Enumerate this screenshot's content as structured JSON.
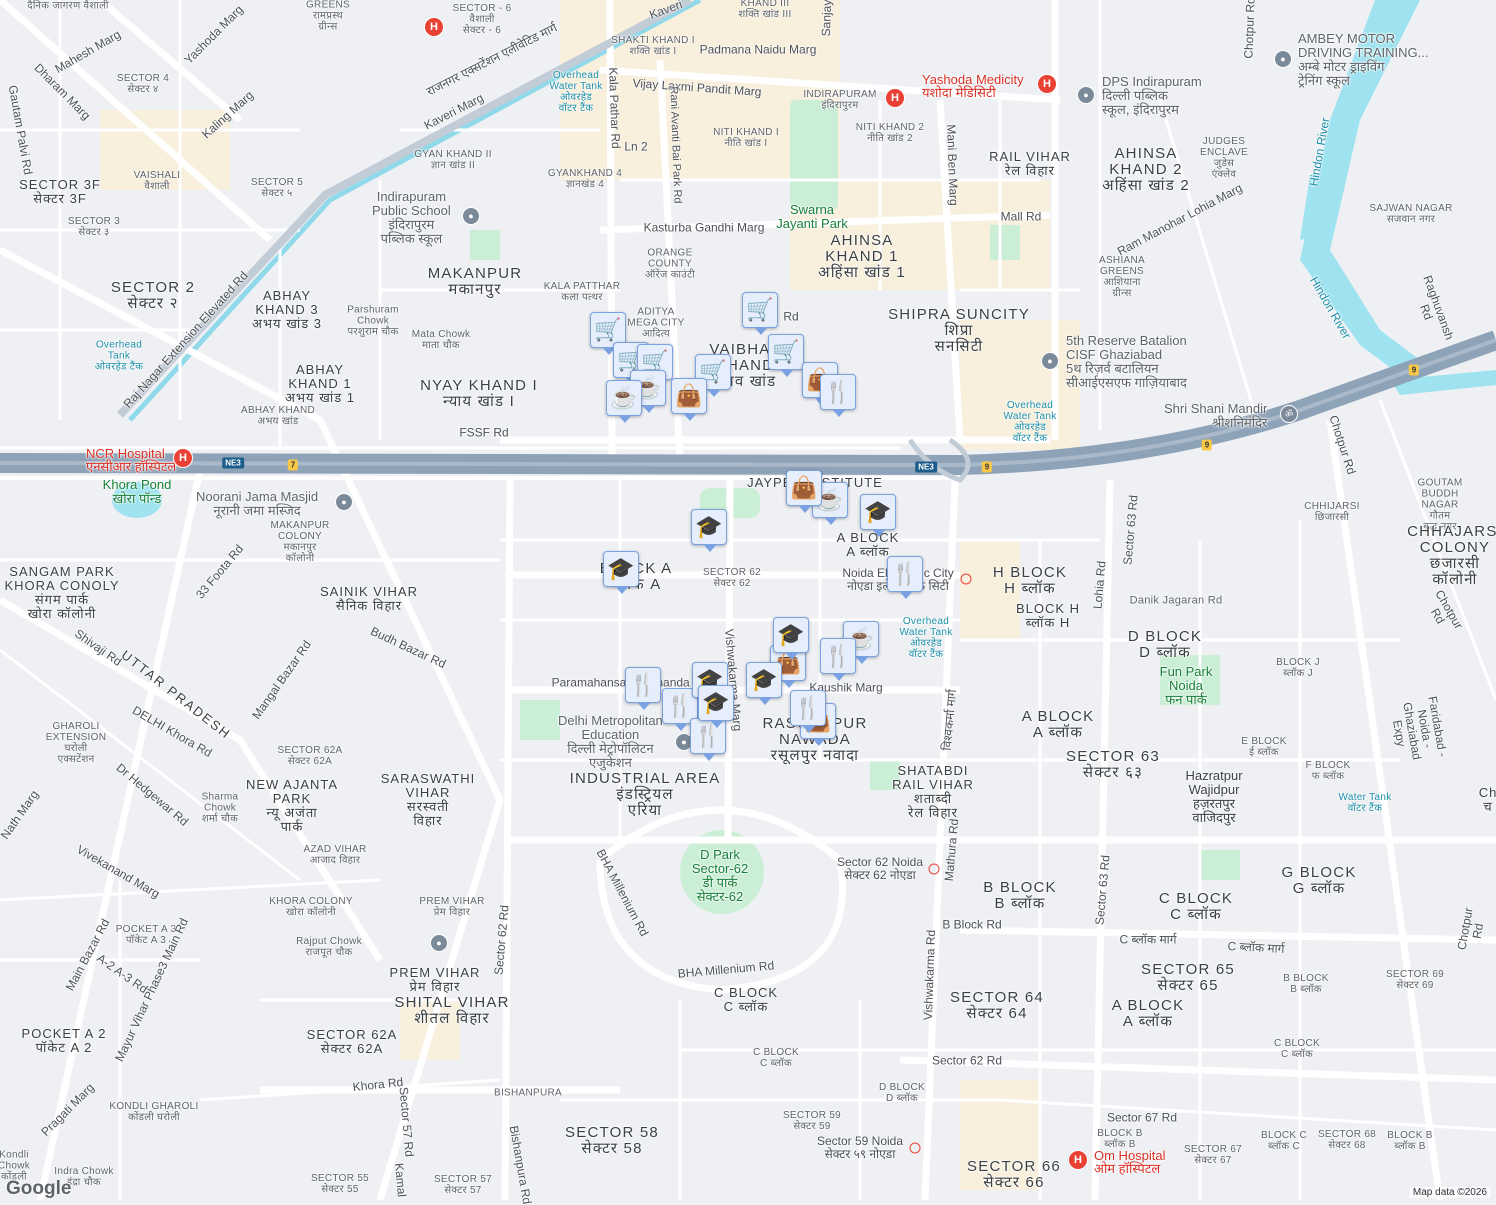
{
  "map": {
    "attribution": "Map data ©2026",
    "logo": "Google",
    "colors": {
      "land": "#eef0f3",
      "road": "#ffffff",
      "highway": "#8ea2b8",
      "water": "#9fe3f0",
      "park": "#cbeed6",
      "urban": "#f8efdc",
      "marker_fill": "#e6eefc",
      "marker_border": "#7aa2e3",
      "marker_icon": "#0b4a70"
    }
  },
  "labels": [
    "दैनिक जागरण वैशाली",
    "GREENS\nरामप्रस्थ\nग्रीन्स",
    "VAISHALI\nSECTOR - 6\nवैशाली\nसेक्टर - 6",
    "KHAND III\nशक्ति खांड III",
    "SHAKTI KHAND I\nशक्ति खांड I",
    "Padmana Naidu Marg",
    "Vijay Laxmi Pandit Marg",
    "Overhead\nWater Tank\nओवरहेड\nवॉटर टैंक",
    "INDIRAPURAM\nइंदिरापुरम",
    "Yashoda Medicity\nयशोदा मेडिसिटी",
    "DPS Indirapuram\nदिल्ली पब्लिक\nस्कूल, इंदिरापुरम",
    "AMBEY MOTOR\nDRIVING TRAINING...\nअम्बे मोटर ड्राइविंग\nट्रेनिंग स्कूल",
    "SECTOR 4\nसेक्टर ४",
    "Mahesh Marg",
    "Yashoda Marg",
    "Dharam Marg",
    "Gautam Palvi Rd",
    "Kaling Marg",
    "VAISHALI\nवैशाली",
    "SECTOR 3F\nसेक्टर 3F",
    "GYAN KHAND II\nज्ञान खांड II",
    "SECTOR 5\nसेक्टर ५",
    "GYANKHAND 4\nज्ञानखंड 4",
    "NITI KHAND I\nनीति खांड I",
    "NITI KHAND 2\nनीति खांड 2",
    "RAIL VIHAR\nरेल विहार",
    "AHINSA\nKHAND 2\nअहिंसा खांड 2",
    "JUDGES\nENCLAVE\nजुडेस\nएंक्लेव",
    "Hindon River",
    "SAJWAN NAGAR\nसजवान नगर",
    "Ram Manohar Lohia Marg",
    "Mall Rd",
    "Swarna\nJayanti Park",
    "Kasturba Gandhi Marg",
    "SECTOR 3\nसेक्टर ३",
    "Indirapuram\nPublic School\nइंदिरापुरम\nपब्लिक स्कूल",
    "AHINSA\nKHAND 1\nअहिंसा खांड 1",
    "ASHIANA\nGREENS\nआशियाना\nग्रीन्स",
    "Hindon River",
    "Raghuvansh Rd",
    "ORANGE\nCOUNTY\nऑरेंज काउंटी",
    "MAKANPUR\nमकानपुर",
    "SECTOR 2\nसेक्टर २",
    "KALA PATTHAR\nकला पत्थर",
    "ABHAY\nKHAND 3\nअभय खांड 3",
    "Parshuram\nChowk\nपरशुराम चौक",
    "ADITYA\nMEGA CITY\nआदित्य",
    "SHIPRA SUNCITY\nशिप्रा\nसनसिटी",
    "5th Reserve Batalion\nCISF Ghaziabad\n5थ रिज़र्व बटालियन\nसीआईएसएफ गाज़ियाबाद",
    "Overhead\nTank\nओवरहेड टैंक",
    "Raj Nagar Extension Elevated Rd",
    "Mata Chowk\nमाता चौक",
    "VAIBHAV\nKHAND\nवैभव खांड",
    "ABHAY\nKHAND 1\nअभय खांड 1",
    "NYAY KHAND I\nन्याय खांड I",
    "ABHAY KHAND\nअभय खांड",
    "Overhead\nWater Tank\nओवरहेड\nवॉटर टैंक",
    "Shri Shani Mandir\nश्रीशनिमंदिर",
    "FSSF Rd",
    "Chotpur Rd",
    "NCR Hospital\nएनसीआर हॉस्पिटल",
    "Khora Pond\nखोरा पॉन्ड",
    "Noorani Jama Masjid\nनूरानी जमा मस्जिद",
    "GOUTAM\nBUDDH NAGAR\nगौतम\nबुद्ध नगर",
    "CHHIJARSI\nछिजारसी",
    "CHHAJARSI\nCOLONY\nछजारसी\nकॉलोनी",
    "Sector 63 Rd",
    "MAKANPUR\nCOLONY\nमकानपुर\nकॉलोनी",
    "33 Foota Rd",
    "JAYPEE INSTITUTE\nOF...",
    "A BLOCK\nA ब्लॉक",
    "SANGAM PARK\nKHORA CONOLY\nसंगम पार्क\nखोरा कॉलोनी",
    "BLOCK A\nब्लॉक A",
    "SECTOR 62\nसेक्टर 62",
    "Noida Electronic City\nनोएडा इलेक्ट्रॉनिक सिटी",
    "H BLOCK\nH ब्लॉक",
    "Lohia Rd",
    "Danik Jagaran Rd",
    "BLOCK H\nब्लॉक H",
    "SAINIK VIHAR\nसैनिक विहार",
    "Shivaji Rd",
    "Budh Bazar Rd",
    "Overhead\nWater Tank\nओवरहेड\nवॉटर टैंक",
    "D BLOCK\nD ब्लॉक",
    "Chotpur Rd",
    "Faridabad - Noida - Ghaziabad Expy",
    "UTTAR PRADESH",
    "Mangal Bazar Rd",
    "Fun Park\nNoida\nफन पार्क",
    "BLOCK J\nब्लॉक J",
    "Paramahansa Yogananda Rd",
    "Kaushik Marg",
    "Vishwakarma Marg",
    "विश्वकर्मा मार्ग",
    "DELHI Khora Rd",
    "A BLOCK\nA ब्लॉक",
    "Delhi Metropolitan\nEducation\nदिल्ली मेट्रोपॉलिटन\nएजुकेशन",
    "RASOOLPUR\nNAWADA\nरसूलपुर नवादा",
    "GHAROLI\nEXTENSION\nघरोली\nएक्सटेंशन",
    "E BLOCK\nई ब्लॉक",
    "SECTOR 63\nसेक्टर ६३",
    "SECTOR 62A\nसेक्टर 62A",
    "Dr Hedgewar Rd",
    "SHATABDI\nRAIL VIHAR\nशताब्दी\nरेल विहार",
    "Hazratpur\nWajidpur\nहज़रतपुर\nवाजिदपुर",
    "F BLOCK\nफ ब्लॉक",
    "Water Tank\nवॉटर टैंक",
    "Ch\nच",
    "INDUSTRIAL AREA\nइंडस्ट्रियल\nएरिया",
    "NEW AJANTA\nPARK\nन्यू अजंता\nपार्क",
    "SARASWATHI\nVIHAR\nसरस्वती\nविहार",
    "Sharma\nChowk\nशर्मा चौक",
    "Nath Marg",
    "AZAD VIHAR\nआजाद विहार",
    "Vivekanand Marg",
    "D Park\nSector-62\nडी पार्क\nसेक्टर-62",
    "Sector 62 Noida\nसेक्टर 62 नोएडा",
    "Mathura Rd",
    "BHA Millenium Rd",
    "B BLOCK\nB ब्लॉक",
    "G BLOCK\nG ब्लॉक",
    "KHORA COLONY\nखोरा कॉलोनी",
    "PREM VIHAR\nप्रेम विहार",
    "Sector 62 Rd",
    "C BLOCK\nC ब्लॉक",
    "Sector 63 Rd",
    "Chotpur Rd",
    "POCKET A 3\nपॉकेट A 3",
    "B Block Rd",
    "C ब्लॉक मार्ग",
    "C ब्लॉक मार्ग",
    "Rajput Chowk\nराजपूत चौक",
    "Main Bazar Rd",
    "Vishwakarma Rd",
    "BHA Millenium Rd",
    "PREM VIHAR\nप्रेम विहार",
    "Mayur Vihar Phase3 Main Rd",
    "A-2 A-3 Rd",
    "SECTOR 65\nसेक्टर 65",
    "B BLOCK\nB ब्लॉक",
    "SECTOR 69\nसेक्टर 69",
    "C BLOCK\nC ब्लॉक",
    "SECTOR 64\nसेक्टर 64",
    "A BLOCK\nA ब्लॉक",
    "SHITAL VIHAR\nशीतल विहार",
    "SECTOR 62A\nसेक्टर 62A",
    "POCKET A 2\nपॉकेट A 2",
    "C BLOCK\nC ब्लॉक",
    "C BLOCK\nC ब्लॉक",
    "Sector 62 Rd",
    "Khora Rd",
    "BISHANPURA",
    "D BLOCK\nD ब्लॉक",
    "Pragati Marg",
    "KONDLI GHAROLI\nकोंडली घरोली",
    "Sector 57 Rd",
    "SECTOR 59\nसेक्टर 59",
    "Sector 67 Rd",
    "Bishanpura Rd",
    "SECTOR 58\nसेक्टर 58",
    "Sector 59 Noida\nसेक्टर ५९ नोएडा",
    "BLOCK B\nब्लॉक B",
    "BLOCK C\nब्लॉक C",
    "SECTOR 68\nसेक्टर 68",
    "BLOCK B\nब्लॉक B",
    "SECTOR 67\nसेक्टर 67",
    "Om Hospital\nओम हॉस्पिटल",
    "SECTOR 66\nसेक्टर 66",
    "Indra Chowk\nइंद्रा चौक",
    "Kondli\nChowk\nकोंडली",
    "SECTOR 55\nसेक्टर 55",
    "SECTOR 57\nसेक्टर 57",
    "Kamal",
    "राजनगर एक्सटेंशन एलीवेटिड मार्ग",
    "Kaveri Marg",
    "Kaveri",
    "Kala Pathar Rd",
    "Rani Avanti Bai Park Rd",
    "Ln 2",
    "Mani Ben Marg",
    "Chotpur Rd",
    "Sanjay",
    "Rd"
  ],
  "shields": [
    "NE3",
    "7",
    "NE3",
    "9",
    "9",
    "9"
  ],
  "markers": [
    {
      "type": "shopping-cart",
      "glyph": "🛒"
    },
    {
      "type": "shopping-cart",
      "glyph": "🛒"
    },
    {
      "type": "shopping-cart",
      "glyph": "🛒"
    },
    {
      "type": "shopping-cart",
      "glyph": "🛒"
    },
    {
      "type": "shopping-cart",
      "glyph": "🛒"
    },
    {
      "type": "shopping-cart",
      "glyph": "🛒"
    },
    {
      "type": "coffee-cup",
      "glyph": "☕"
    },
    {
      "type": "coffee-cup",
      "glyph": "☕"
    },
    {
      "type": "coffee-cup",
      "glyph": "☕"
    },
    {
      "type": "coffee-cup",
      "glyph": "☕"
    },
    {
      "type": "shopping-bag",
      "glyph": "👜"
    },
    {
      "type": "shopping-bag",
      "glyph": "👜"
    },
    {
      "type": "shopping-bag",
      "glyph": "👜"
    },
    {
      "type": "shopping-bag",
      "glyph": "👜"
    },
    {
      "type": "shopping-bag",
      "glyph": "👜"
    },
    {
      "type": "restaurant",
      "glyph": "🍴"
    },
    {
      "type": "restaurant",
      "glyph": "🍴"
    },
    {
      "type": "restaurant",
      "glyph": "🍴"
    },
    {
      "type": "restaurant",
      "glyph": "🍴"
    },
    {
      "type": "restaurant",
      "glyph": "🍴"
    },
    {
      "type": "restaurant",
      "glyph": "🍴"
    },
    {
      "type": "restaurant",
      "glyph": "🍴"
    },
    {
      "type": "school",
      "glyph": "🎓"
    },
    {
      "type": "school",
      "glyph": "🎓"
    },
    {
      "type": "school",
      "glyph": "🎓"
    },
    {
      "type": "school",
      "glyph": "🎓"
    },
    {
      "type": "school",
      "glyph": "🎓"
    },
    {
      "type": "school",
      "glyph": "🎓"
    },
    {
      "type": "school",
      "glyph": "🎓"
    }
  ],
  "pins": {
    "hospital": "H",
    "place": "●",
    "temple": "ॐ"
  }
}
